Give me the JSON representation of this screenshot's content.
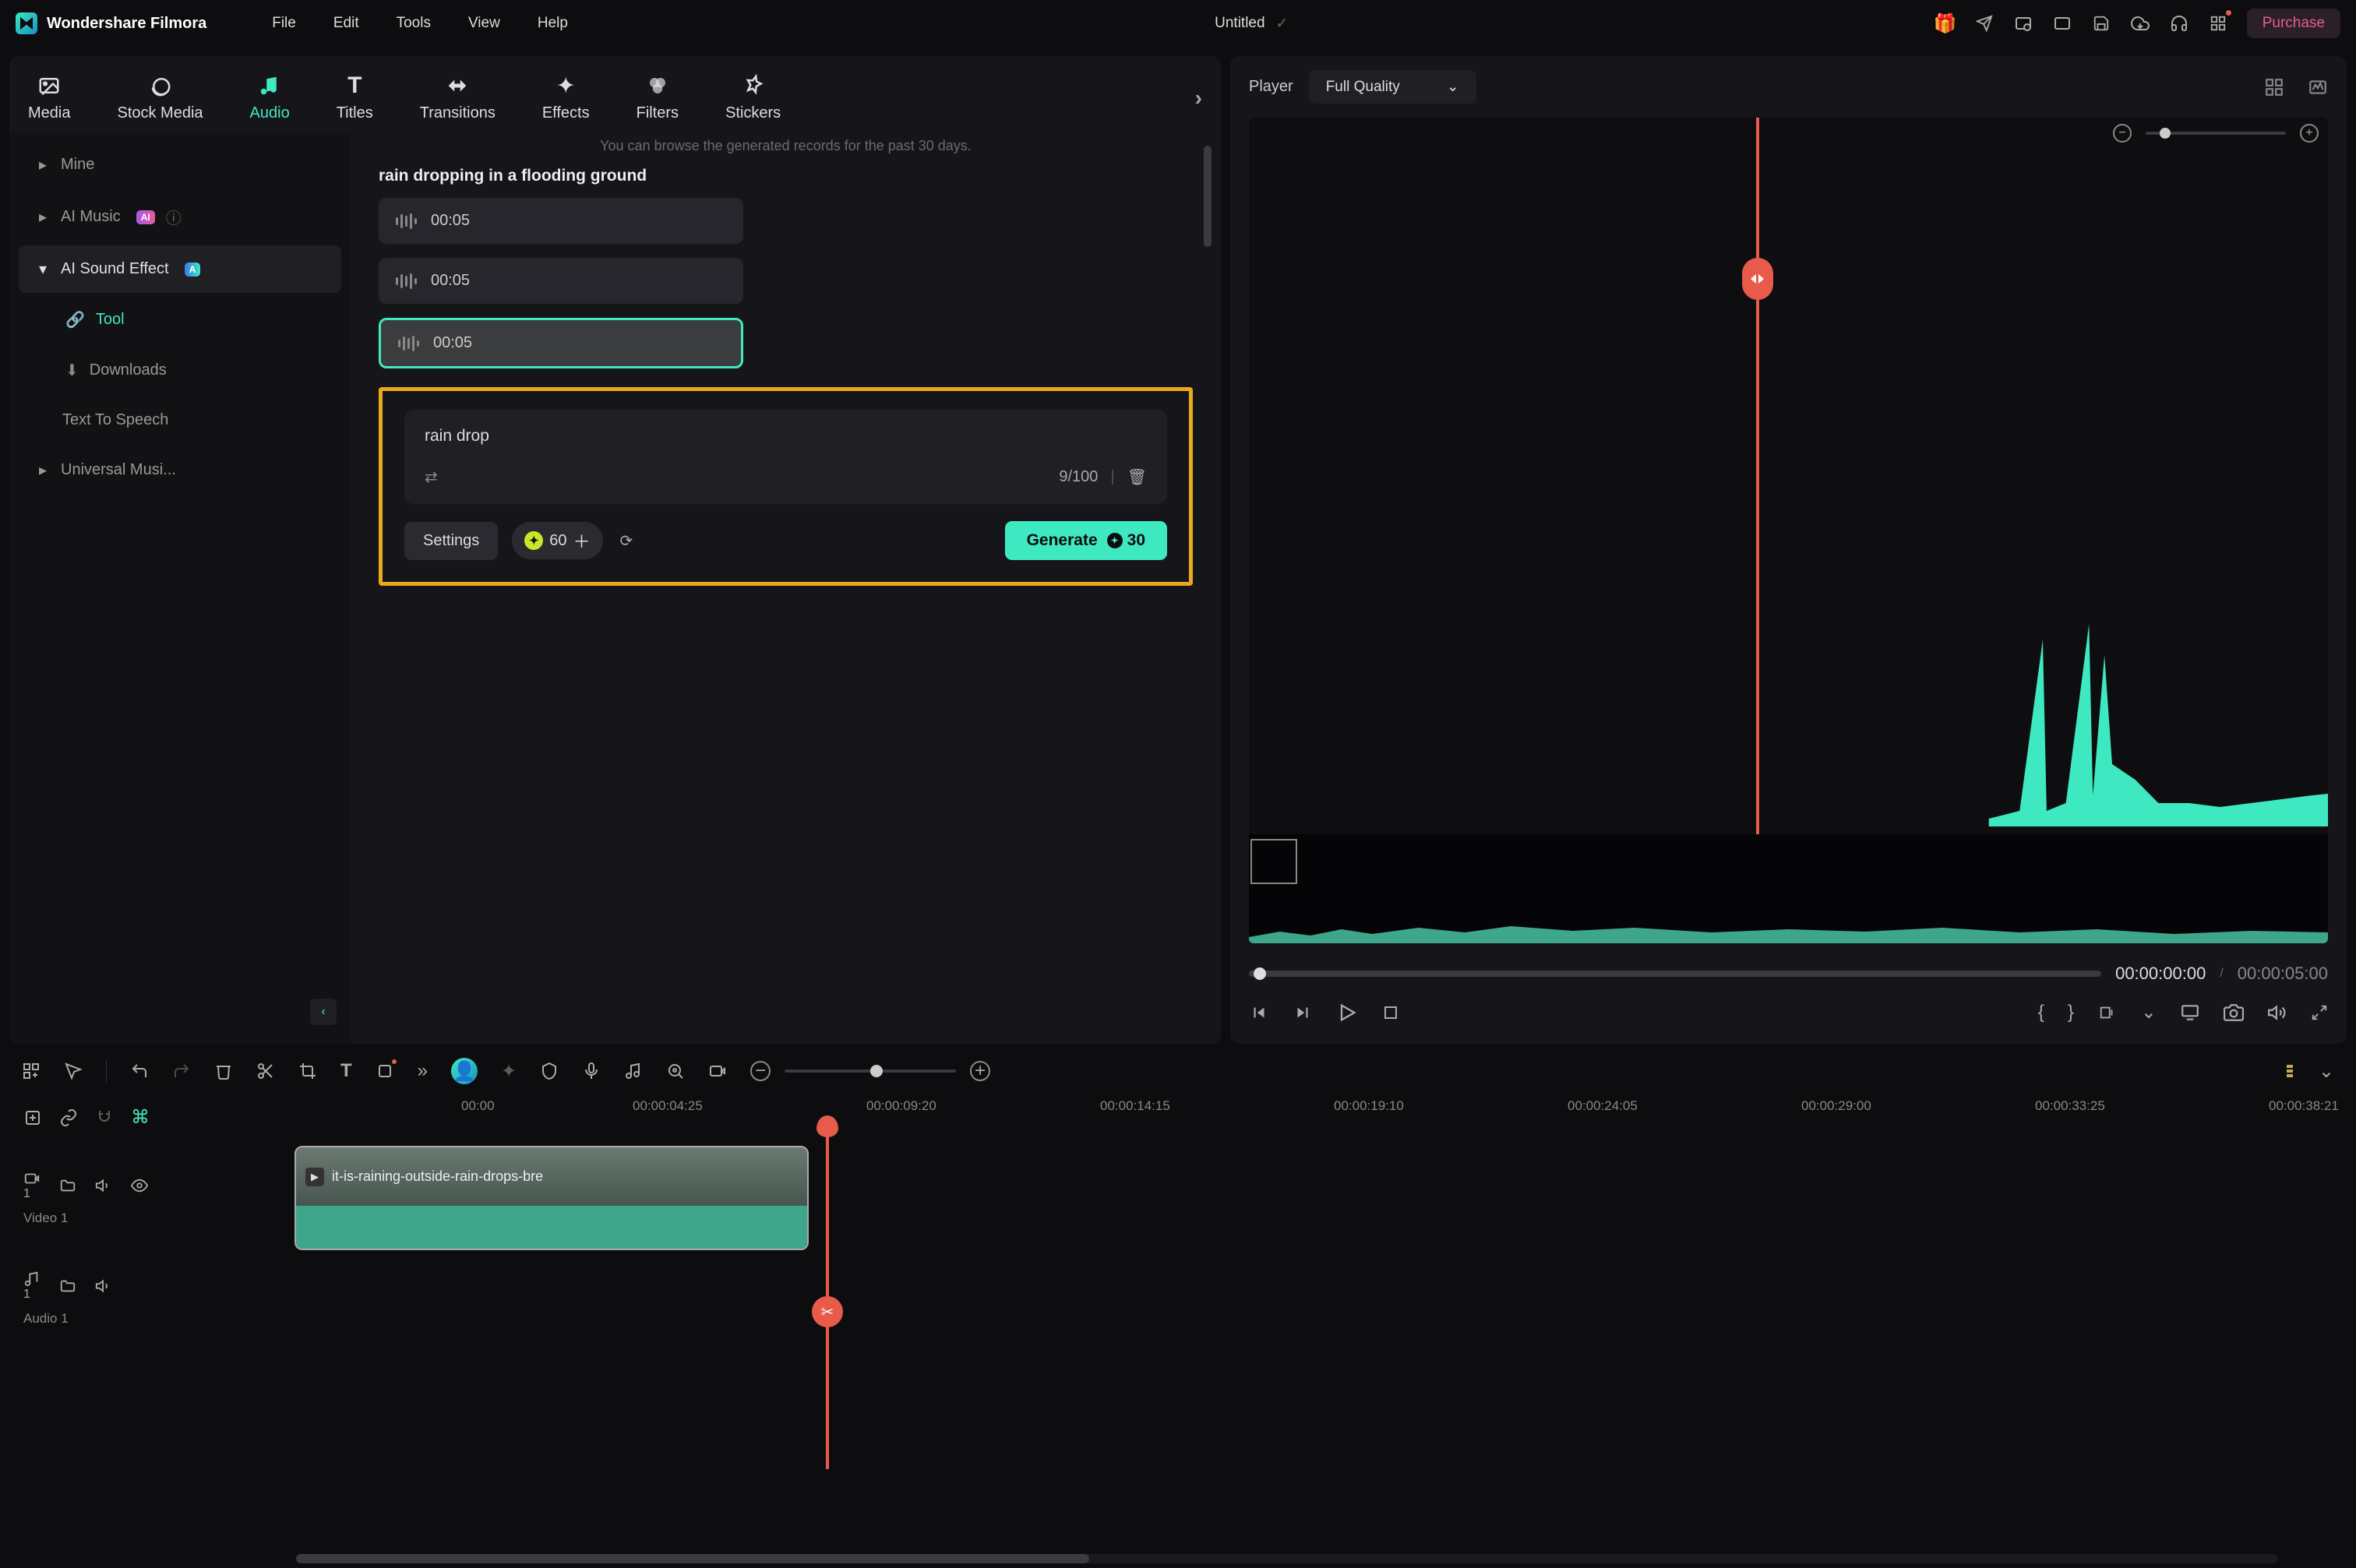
{
  "app": {
    "name": "Wondershare Filmora"
  },
  "menu": {
    "file": "File",
    "edit": "Edit",
    "tools": "Tools",
    "view": "View",
    "help": "Help"
  },
  "project": {
    "name": "Untitled"
  },
  "purchase": "Purchase",
  "tabs": {
    "media": "Media",
    "stock": "Stock Media",
    "audio": "Audio",
    "titles": "Titles",
    "transitions": "Transitions",
    "effects": "Effects",
    "filters": "Filters",
    "stickers": "Stickers"
  },
  "sidebar": {
    "mine": "Mine",
    "ai_music": "AI Music",
    "ai_sound": "AI Sound Effect",
    "tool": "Tool",
    "downloads": "Downloads",
    "tts": "Text To Speech",
    "universal": "Universal Musi..."
  },
  "gen": {
    "note": "You can browse the generated records for the past 30 days.",
    "title": "rain dropping in a flooding ground",
    "clip1": "00:05",
    "clip2": "00:05",
    "clip3": "00:05",
    "prompt": "rain drop",
    "count": "9/100",
    "settings": "Settings",
    "credits": "60",
    "generate": "Generate",
    "cost": "30"
  },
  "player": {
    "label": "Player",
    "quality": "Full Quality",
    "current": "00:00:00:00",
    "total": "00:00:05:00"
  },
  "ruler": {
    "t0": "00:00",
    "t1": "00:00:04:25",
    "t2": "00:00:09:20",
    "t3": "00:00:14:15",
    "t4": "00:00:19:10",
    "t5": "00:00:24:05",
    "t6": "00:00:29:00",
    "t7": "00:00:33:25",
    "t8": "00:00:38:21"
  },
  "tracks": {
    "video": {
      "label": "Video 1",
      "clip": "it-is-raining-outside-rain-drops-bre"
    },
    "audio": {
      "label": "Audio 1"
    }
  }
}
